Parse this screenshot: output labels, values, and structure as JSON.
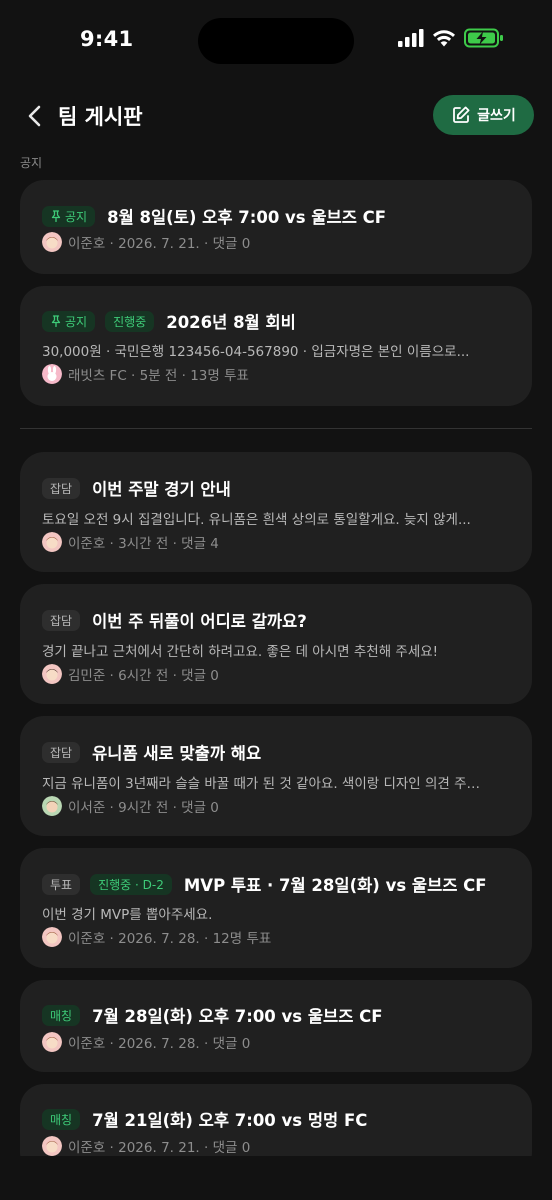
{
  "status": {
    "time": "9:41"
  },
  "header": {
    "title": "팀 게시판",
    "write_label": "글쓰기"
  },
  "section": {
    "notice_label": "공지"
  },
  "notices": [
    {
      "badges": [
        "공지"
      ],
      "title": "8월 8일(토) 오후 7:00 vs 울브즈 CF",
      "meta": "이준호 · 2026. 7. 21. · 댓글 0"
    },
    {
      "badges": [
        "공지",
        "진행중"
      ],
      "title": "2026년 8월 회비",
      "snippet": "30,000원 · 국민은행 123456-04-567890 · 입금자명은 본인 이름으로...",
      "meta": "래빗츠 FC · 5분 전 · 13명 투표"
    }
  ],
  "posts": [
    {
      "category": "잡담",
      "title": "이번 주말 경기 안내",
      "snippet": "토요일 오전 9시 집결입니다. 유니폼은 흰색 상의로 통일할게요. 늦지 않게...",
      "meta": "이준호 · 3시간 전 · 댓글 4"
    },
    {
      "category": "잡담",
      "title": "이번 주 뒤풀이 어디로 갈까요?",
      "snippet": "경기 끝나고 근처에서 간단히 하려고요. 좋은 데 아시면 추천해 주세요!",
      "meta": "김민준 · 6시간 전 · 댓글 0"
    },
    {
      "category": "잡담",
      "title": "유니폼 새로 맞출까 해요",
      "snippet": "지금 유니폼이 3년째라 슬슬 바꿀 때가 된 것 같아요. 색이랑 디자인 의견 주…",
      "meta": "이서준 · 9시간 전 · 댓글 0"
    },
    {
      "category": "투표",
      "status": "진행중 · D-2",
      "title": "MVP 투표 · 7월 28일(화) vs 울브즈 CF",
      "snippet": "이번 경기 MVP를 뽑아주세요.",
      "meta": "이준호 · 2026. 7. 28. · 12명 투표"
    },
    {
      "category": "매칭",
      "title": "7월 28일(화) 오후 7:00 vs 울브즈 CF",
      "meta": "이준호 · 2026. 7. 28. · 댓글 0"
    },
    {
      "category": "매칭",
      "title": "7월 21일(화) 오후 7:00 vs 멍멍 FC",
      "meta": "이준호 · 2026. 7. 21. · 댓글 0"
    }
  ],
  "colors": {
    "accent": "#1f6b43",
    "badge_green_text": "#3ecb78",
    "background": "#121212",
    "card": "#202020"
  }
}
